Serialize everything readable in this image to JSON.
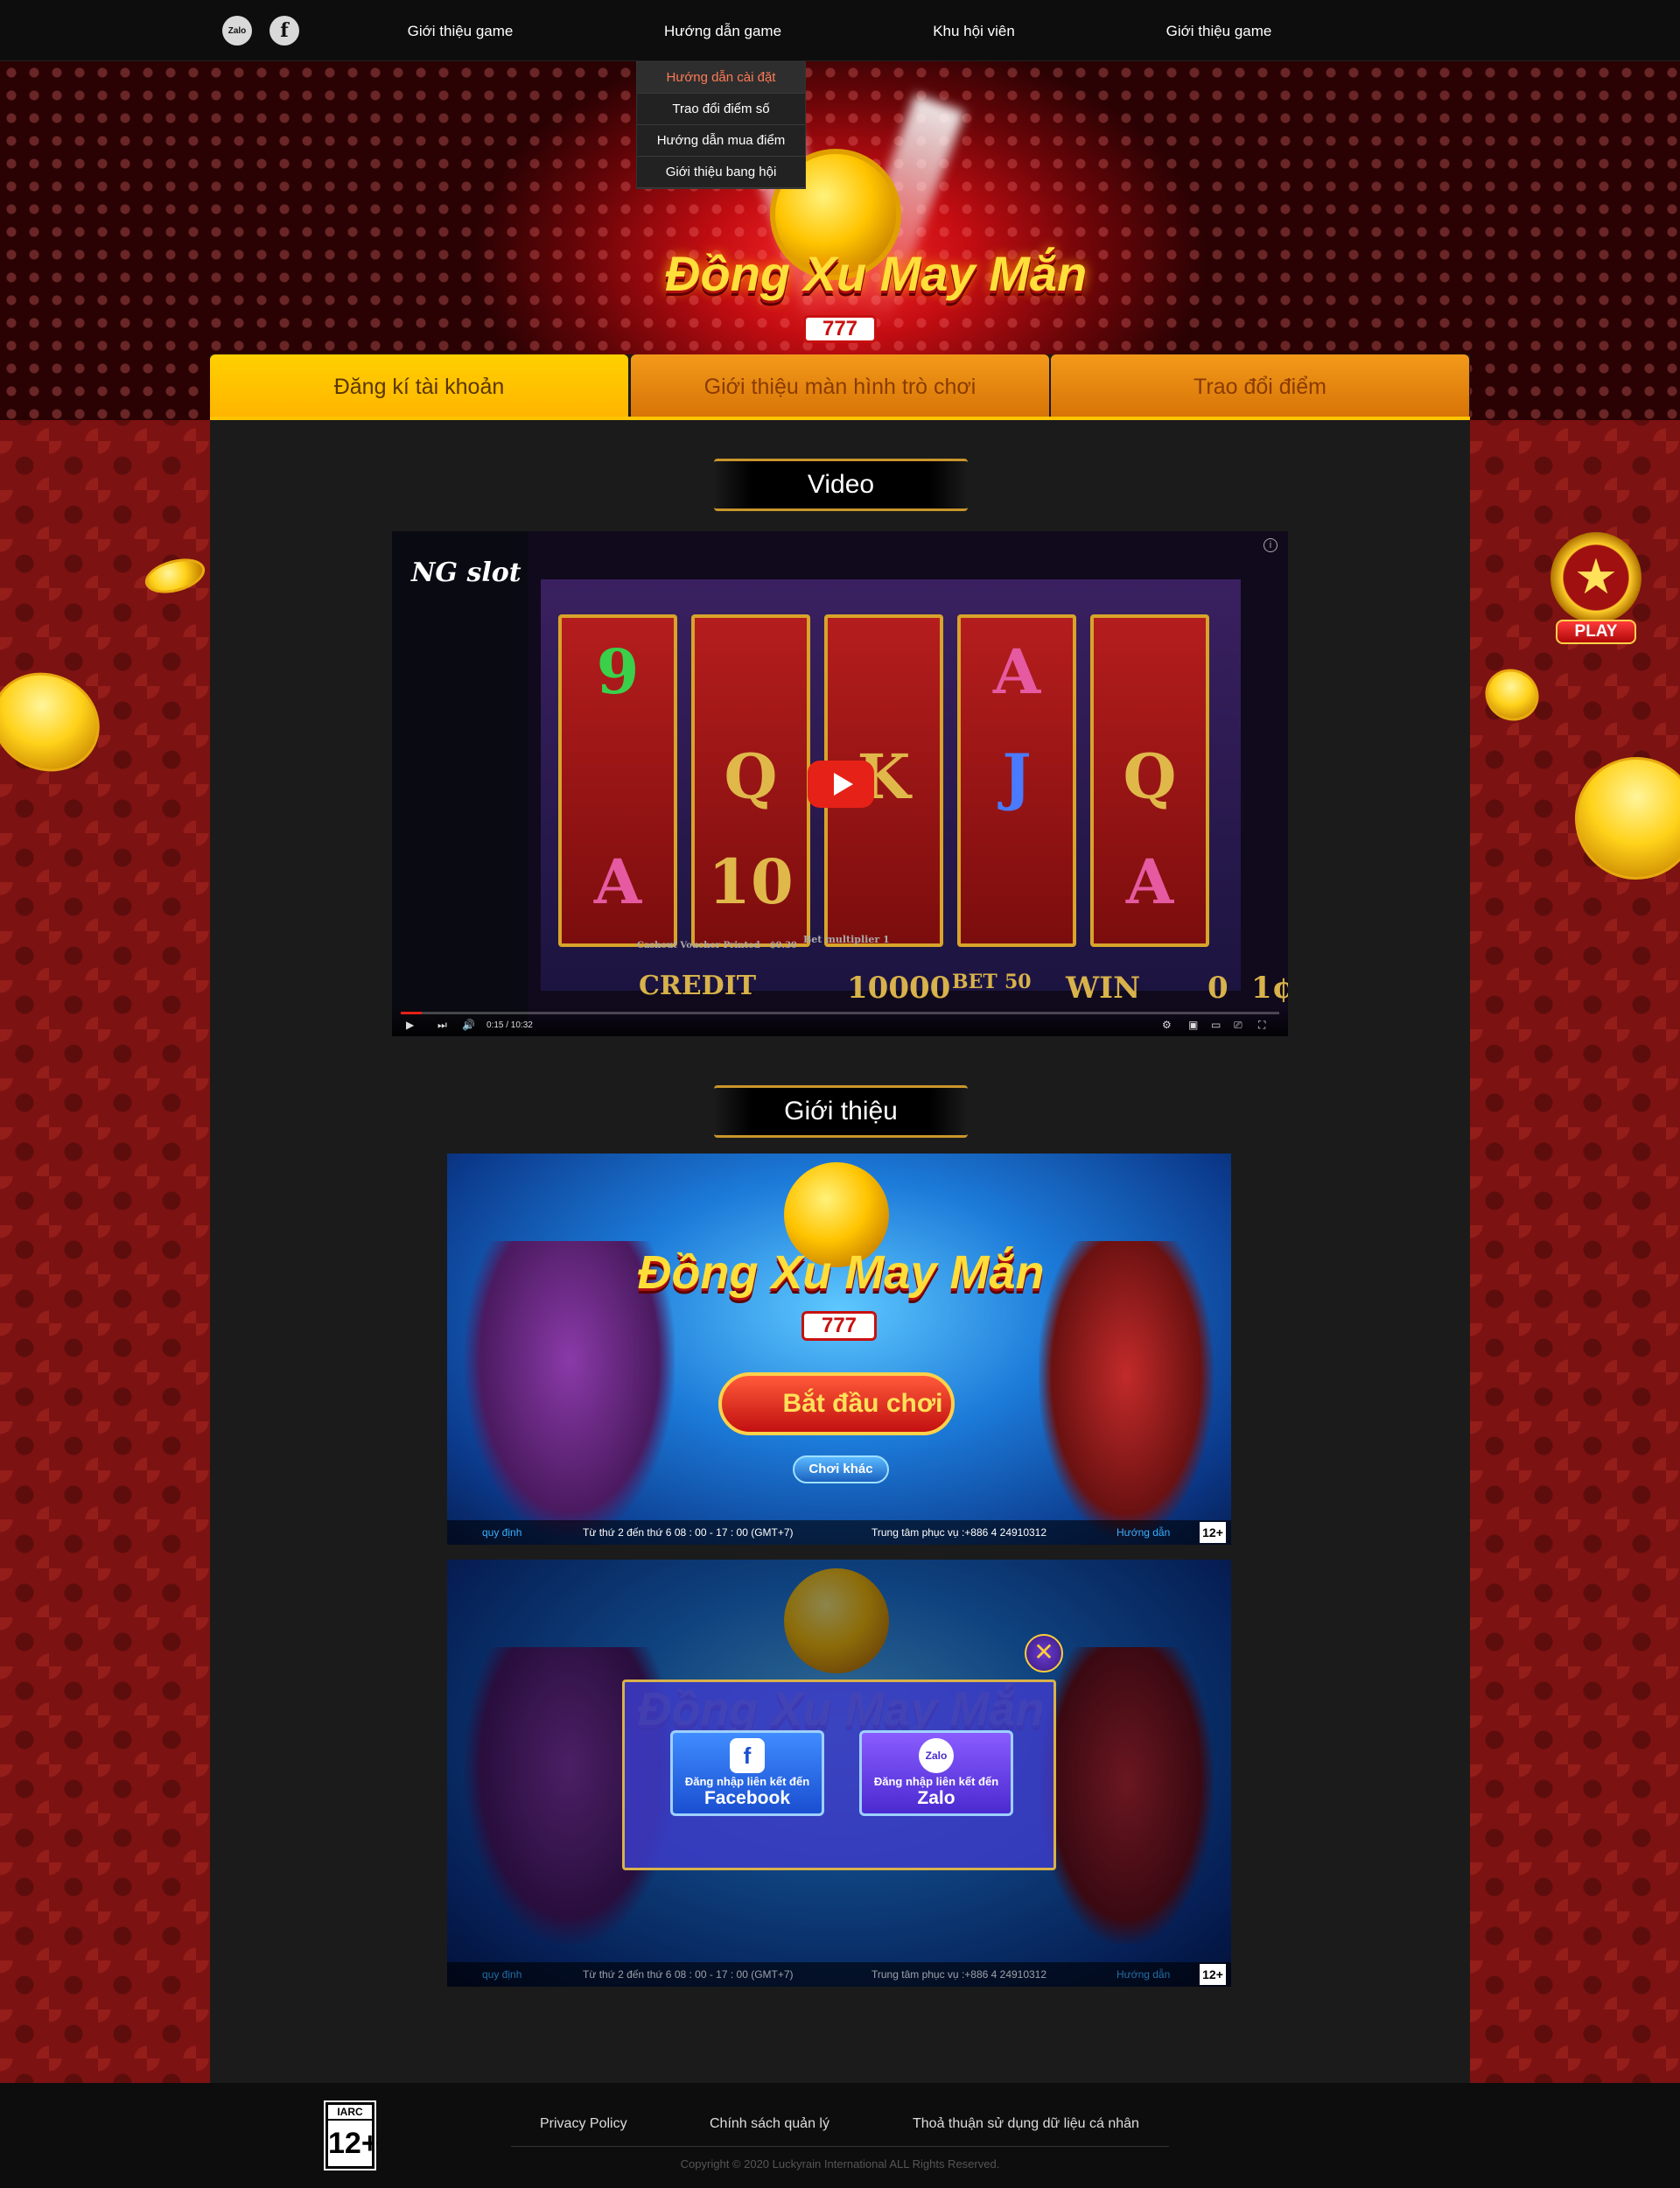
{
  "social": {
    "zalo_label": "Zalo",
    "facebook_label": "f"
  },
  "nav": {
    "items": [
      "Giới thiệu game",
      "Hướng dẫn game",
      "Khu hội viên",
      "Giới thiệu game"
    ],
    "dropdown": [
      "Hướng dẫn cài đặt",
      "Trao đổi điểm số",
      "Hướng dẫn mua điểm",
      "Giới thiệu bang hội"
    ]
  },
  "hero": {
    "logo_title": "Đồng Xu May Mắn",
    "logo_badge": "777"
  },
  "tabs": [
    "Đăng kí tài khoản",
    "Giới thiệu màn hình trò chơi",
    "Trao đổi điểm"
  ],
  "video_section": {
    "title": "Video",
    "channel": "NG slot",
    "symbols": [
      "9",
      "Q",
      "A",
      "Q",
      "10",
      "K",
      "A",
      "J",
      "A",
      "Q"
    ],
    "hud": {
      "credit_label": "CREDIT",
      "credit": "10000",
      "bet_label": "BET",
      "bet": "50",
      "win_label": "WIN",
      "win": "0",
      "denom": "1¢",
      "multiplier": "Bet multiplier 1",
      "voucher": "Cashout Voucher Printed - $0.30"
    },
    "time": "0:15 / 10:32",
    "progress": 0.024
  },
  "intro_section": {
    "title": "Giới thiệu",
    "game_title": "Đồng Xu May Mắn",
    "badge": "777",
    "start_button": "Bắt đầu chơi",
    "other_button": "Chơi khác",
    "strip": {
      "rules_link": "quy định",
      "hours": "Từ thứ 2 đến thứ 6 08 : 00 - 17 : 00 (GMT+7)",
      "support": "Trung tâm phục vụ :+886 4 24910312",
      "guide_link": "Hướng dẫn",
      "age": "12+"
    },
    "login_modal": {
      "facebook_line1": "Đăng nhập liên kết đến",
      "facebook_line2": "Facebook",
      "zalo_line1": "Đăng nhập liên kết đến",
      "zalo_line2": "Zalo",
      "zalo_icon_text": "Zalo"
    }
  },
  "play_badge": {
    "label": "PLAY"
  },
  "footer": {
    "iarc": "IARC",
    "age": "12+",
    "links": [
      "Privacy Policy",
      "Chính sách quản lý",
      "Thoả thuận sử dụng dữ liệu cá nhân"
    ],
    "copyright": "Copyright © 2020 Luckyrain International  ALL Rights Reserved."
  },
  "colors": {
    "accent": "#ffc400",
    "tab_inactive": "#e8860f",
    "background_red": "#7d1212",
    "panel": "#1b1b1b",
    "dropdown_active": "#ff7a55"
  }
}
